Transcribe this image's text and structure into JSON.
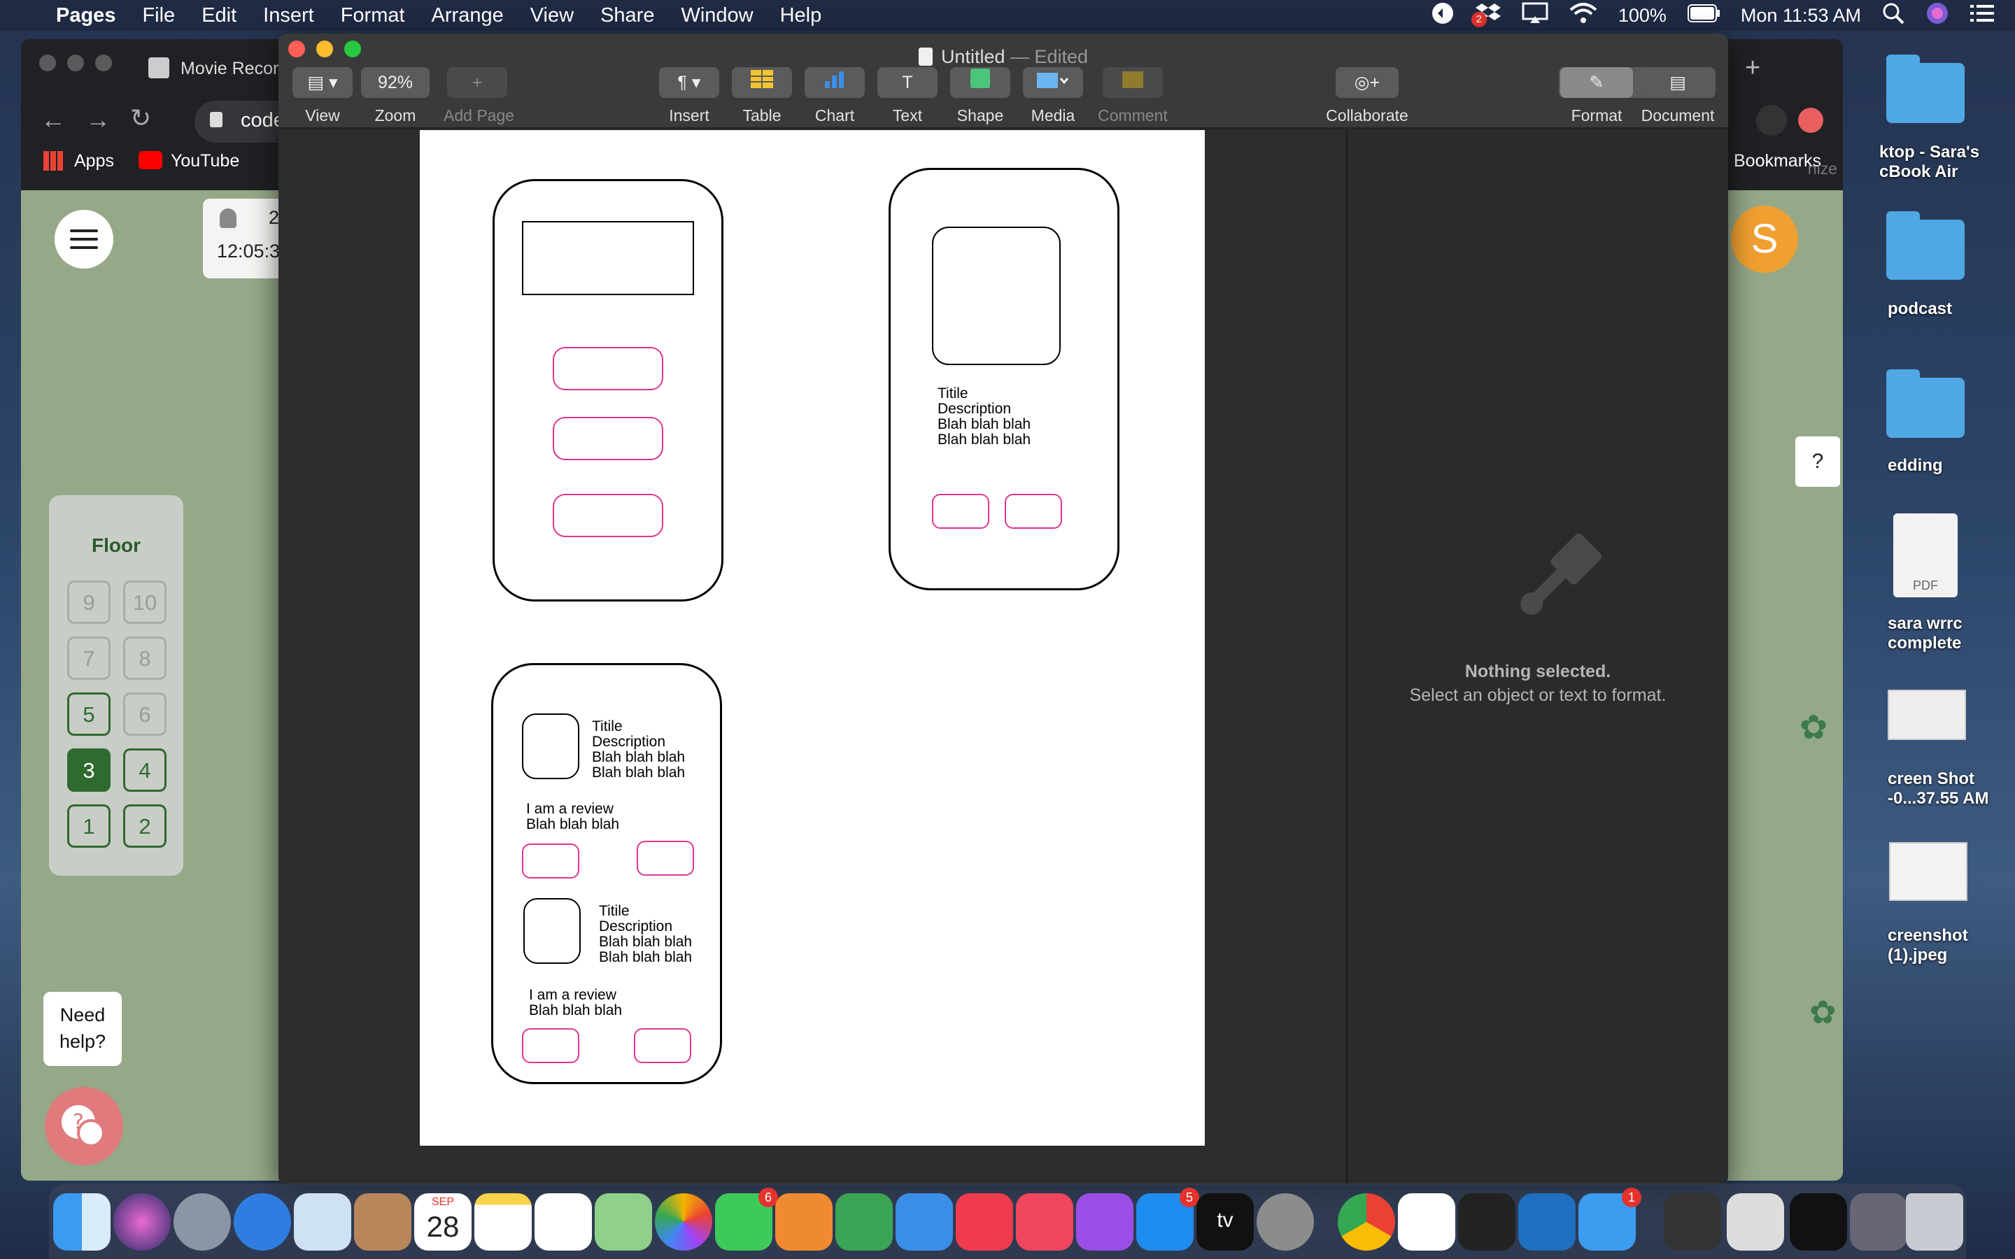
{
  "menubar": {
    "app_name": "Pages",
    "items": [
      "File",
      "Edit",
      "Insert",
      "Format",
      "Arrange",
      "View",
      "Share",
      "Window",
      "Help"
    ],
    "battery": "100%",
    "clock": "Mon 11:53 AM",
    "dropbox_badge": "2"
  },
  "desktop": {
    "items": [
      {
        "label1": "ktop - Sara's",
        "label2": "cBook Air"
      },
      {
        "label1": "podcast",
        "label2": ""
      },
      {
        "label1": "edding",
        "label2": ""
      },
      {
        "label1": "sara wrrc",
        "label2": "complete"
      },
      {
        "label1": "creen Shot",
        "label2": "-0...37.55 AM"
      },
      {
        "label1": "creenshot",
        "label2": "(1).jpeg"
      }
    ],
    "pdf_label": "PDF"
  },
  "chrome": {
    "tab_title": "Movie Recor",
    "url": "codefe",
    "bookmarks": {
      "apps": "Apps",
      "youtube": "YouTube",
      "right": "Bookmarks"
    },
    "time_card": {
      "number": "2",
      "time": "12:05:3"
    },
    "floor_panel": {
      "title": "Floor",
      "buttons": [
        {
          "label": "9",
          "state": "off"
        },
        {
          "label": "10",
          "state": "off"
        },
        {
          "label": "7",
          "state": "off"
        },
        {
          "label": "8",
          "state": "off"
        },
        {
          "label": "5",
          "state": "on"
        },
        {
          "label": "6",
          "state": "off"
        },
        {
          "label": "3",
          "state": "sel"
        },
        {
          "label": "4",
          "state": "on"
        },
        {
          "label": "1",
          "state": "on"
        },
        {
          "label": "2",
          "state": "on"
        }
      ]
    },
    "help_bubble": {
      "line1": "Need",
      "line2": "help?"
    },
    "avatar_letter": "S",
    "question_label": "?",
    "partial_right": "nize"
  },
  "pages": {
    "doc_title": "Untitled",
    "doc_status": "— Edited",
    "toolbar": {
      "view": "View",
      "zoom": "Zoom",
      "zoom_value": "92%",
      "add_page": "Add Page",
      "insert": "Insert",
      "table": "Table",
      "chart": "Chart",
      "text": "Text",
      "shape": "Shape",
      "media": "Media",
      "comment": "Comment",
      "collaborate": "Collaborate",
      "format": "Format",
      "document": "Document"
    },
    "sidebar": {
      "heading": "Nothing selected.",
      "subtext": "Select an object or text to format."
    },
    "wireframe": {
      "screen2_text": "Titile\nDescription\nBlah blah blah\nBlah blah blah",
      "screen3_item1": "Titile\nDescription\nBlah blah blah\nBlah blah blah",
      "screen3_review1": "I am a review\nBlah blah blah",
      "screen3_item2": "Titile\nDescription\nBlah blah blah\nBlah blah blah",
      "screen3_review2": "I am a review\nBlah blah blah"
    }
  },
  "dock": {
    "calendar_month": "SEP",
    "calendar_day": "28",
    "facetime_badge": "6",
    "appstore_badge": "5",
    "messages_badge": "1",
    "appletv_label": "tv"
  },
  "colors": {
    "wire_pink": "#e0358f",
    "floor_green": "#2f6a2f",
    "chrome_page_bg": "#95a888",
    "avatar_orange": "#f0a030"
  }
}
